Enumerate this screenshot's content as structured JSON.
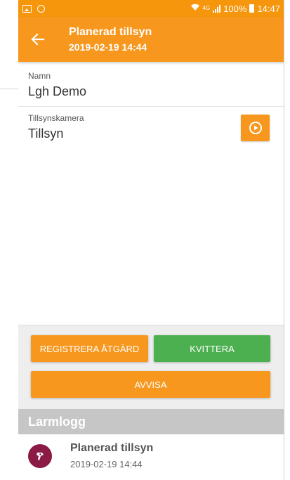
{
  "status_bar": {
    "battery": "100%",
    "time": "14:47",
    "network": "4G"
  },
  "toolbar": {
    "title": "Planerad tillsyn",
    "subtitle": "2019-02-19 14:44",
    "back_icon": "arrow-left-icon"
  },
  "fields": {
    "name": {
      "label": "Namn",
      "value": "Lgh Demo"
    },
    "camera": {
      "label": "Tillsynskamera",
      "value": "Tillsyn",
      "action_icon": "play-circle-icon"
    }
  },
  "actions": {
    "register_label": "REGISTRERA ÅTGÄRD",
    "acknowledge_label": "KVITTERA",
    "reject_label": "AVVISA"
  },
  "log": {
    "header": "Larmlogg",
    "items": [
      {
        "title": "Planerad tillsyn",
        "time": "2019-02-19 14:44",
        "icon": "planned-visit-icon"
      }
    ]
  },
  "colors": {
    "accent": "#f7971d",
    "success": "#4caf50",
    "log_header_bg": "#c6c6c6",
    "avatar_bg": "#8b1a44"
  }
}
